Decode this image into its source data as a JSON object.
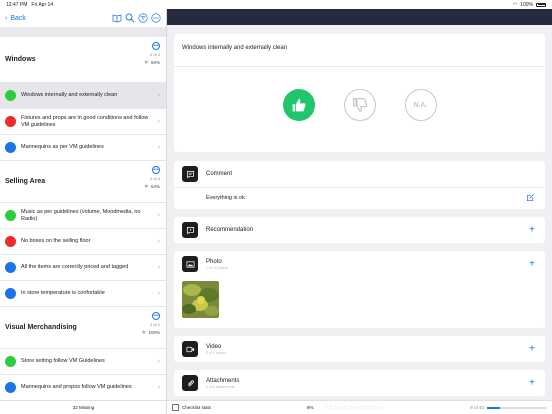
{
  "status": {
    "time": "12:47 PM",
    "date": "Fri Apr 14",
    "battery": "100%"
  },
  "nav": {
    "back_label": "Back"
  },
  "sections": [
    {
      "title": "Windows",
      "count": "3 of 3",
      "percent": "50%",
      "items": [
        {
          "label": "Windows internally and externally clean",
          "color": "#2ecc40",
          "selected": true
        },
        {
          "label": "Fixtures and props are in good conditions and follow VM guidelines",
          "color": "#ee2b2b"
        },
        {
          "label": "Mannequins as per VM guidelines",
          "color": "#1a73e8"
        }
      ]
    },
    {
      "title": "Selling Area",
      "count": "4 of 4",
      "percent": "54%",
      "items": [
        {
          "label": "Music as per guidelines (volume, Moodmedia, no Radio)",
          "color": "#2ecc40"
        },
        {
          "label": "No boxes on the selling floor",
          "color": "#ee2b2b"
        },
        {
          "label": "All the items are correctly priced and tagged",
          "color": "#1a73e8"
        },
        {
          "label": "In store temperature is confortable",
          "color": "#1a73e8"
        }
      ]
    },
    {
      "title": "Visual Merchandising",
      "count": "2 of 2",
      "percent": "100%",
      "items": [
        {
          "label": "Store setting follow VM Guidelines",
          "color": "#2ecc40"
        },
        {
          "label": "Mannequins and propos follow VM guidelines",
          "color": "#1a73e8"
        }
      ]
    }
  ],
  "left_footer": {
    "missing": "32 Missing"
  },
  "question": {
    "title": "Windows internally and externally clean",
    "na_label": "N.A."
  },
  "comment": {
    "label": "Comment",
    "text": "Everything is ok"
  },
  "recommendation": {
    "label": "Recommendation"
  },
  "photo": {
    "label": "Photo",
    "sub": "1 of 10 photos"
  },
  "video": {
    "label": "Video",
    "sub": "0 of 1 videos"
  },
  "attachments": {
    "label": "Attachments",
    "sub": "0 of 1 attachments"
  },
  "footer": {
    "label": "Checklist stats",
    "percent": "8%",
    "progress_text": "9 of 40",
    "progress": 0.22
  },
  "colors": {
    "accent": "#1a73e8",
    "yes": "#1fc76a",
    "header": "#262a3d"
  }
}
